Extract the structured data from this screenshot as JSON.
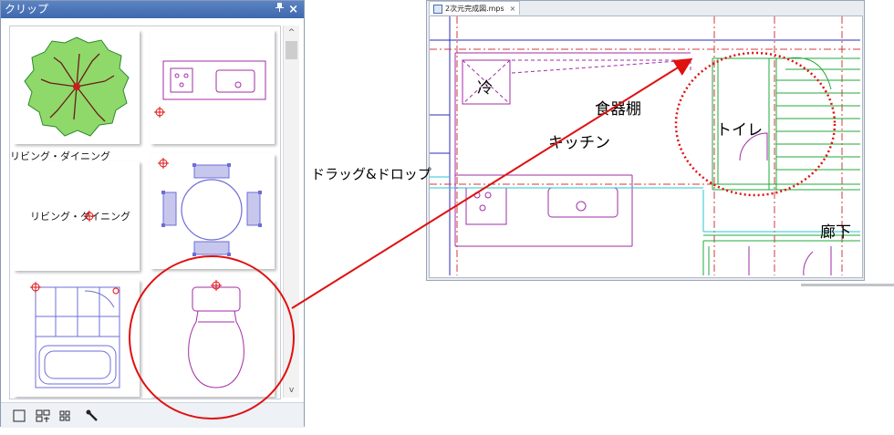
{
  "clip_panel": {
    "title": "クリップ",
    "pin_glyph": "ᵖ",
    "close_glyph": "×",
    "tiles": [
      {
        "kind": "tree"
      },
      {
        "kind": "kitchen-sink"
      },
      {
        "kind": "text",
        "caption": "リビング・ダイニング",
        "inner_text": "リビング・ダイニング"
      },
      {
        "kind": "dining-table"
      },
      {
        "kind": "bathroom"
      },
      {
        "kind": "toilet"
      }
    ],
    "scroll_up": "^",
    "scroll_down": "v",
    "toolbar_icons": [
      "square-icon",
      "layout-icon",
      "grid-icon",
      "wrench-icon"
    ]
  },
  "document": {
    "tab_label": "2次元完成図.mps",
    "tab_close": "×",
    "room_labels": {
      "fridge": "冷",
      "cupboard": "食器棚",
      "kitchen": "キッチン",
      "toilet": "トイレ",
      "hallway": "廊下"
    }
  },
  "annotation": {
    "label": "ドラッグ&ドロップ",
    "color": "#e01010"
  },
  "colors": {
    "cad_magenta": "#a12ea6",
    "cad_green": "#22a83a",
    "cad_cyan": "#27c7d0",
    "cad_red_dash": "#d03b3b",
    "cad_blue": "#2b2bb8",
    "panel_title": "#4a74b8"
  }
}
